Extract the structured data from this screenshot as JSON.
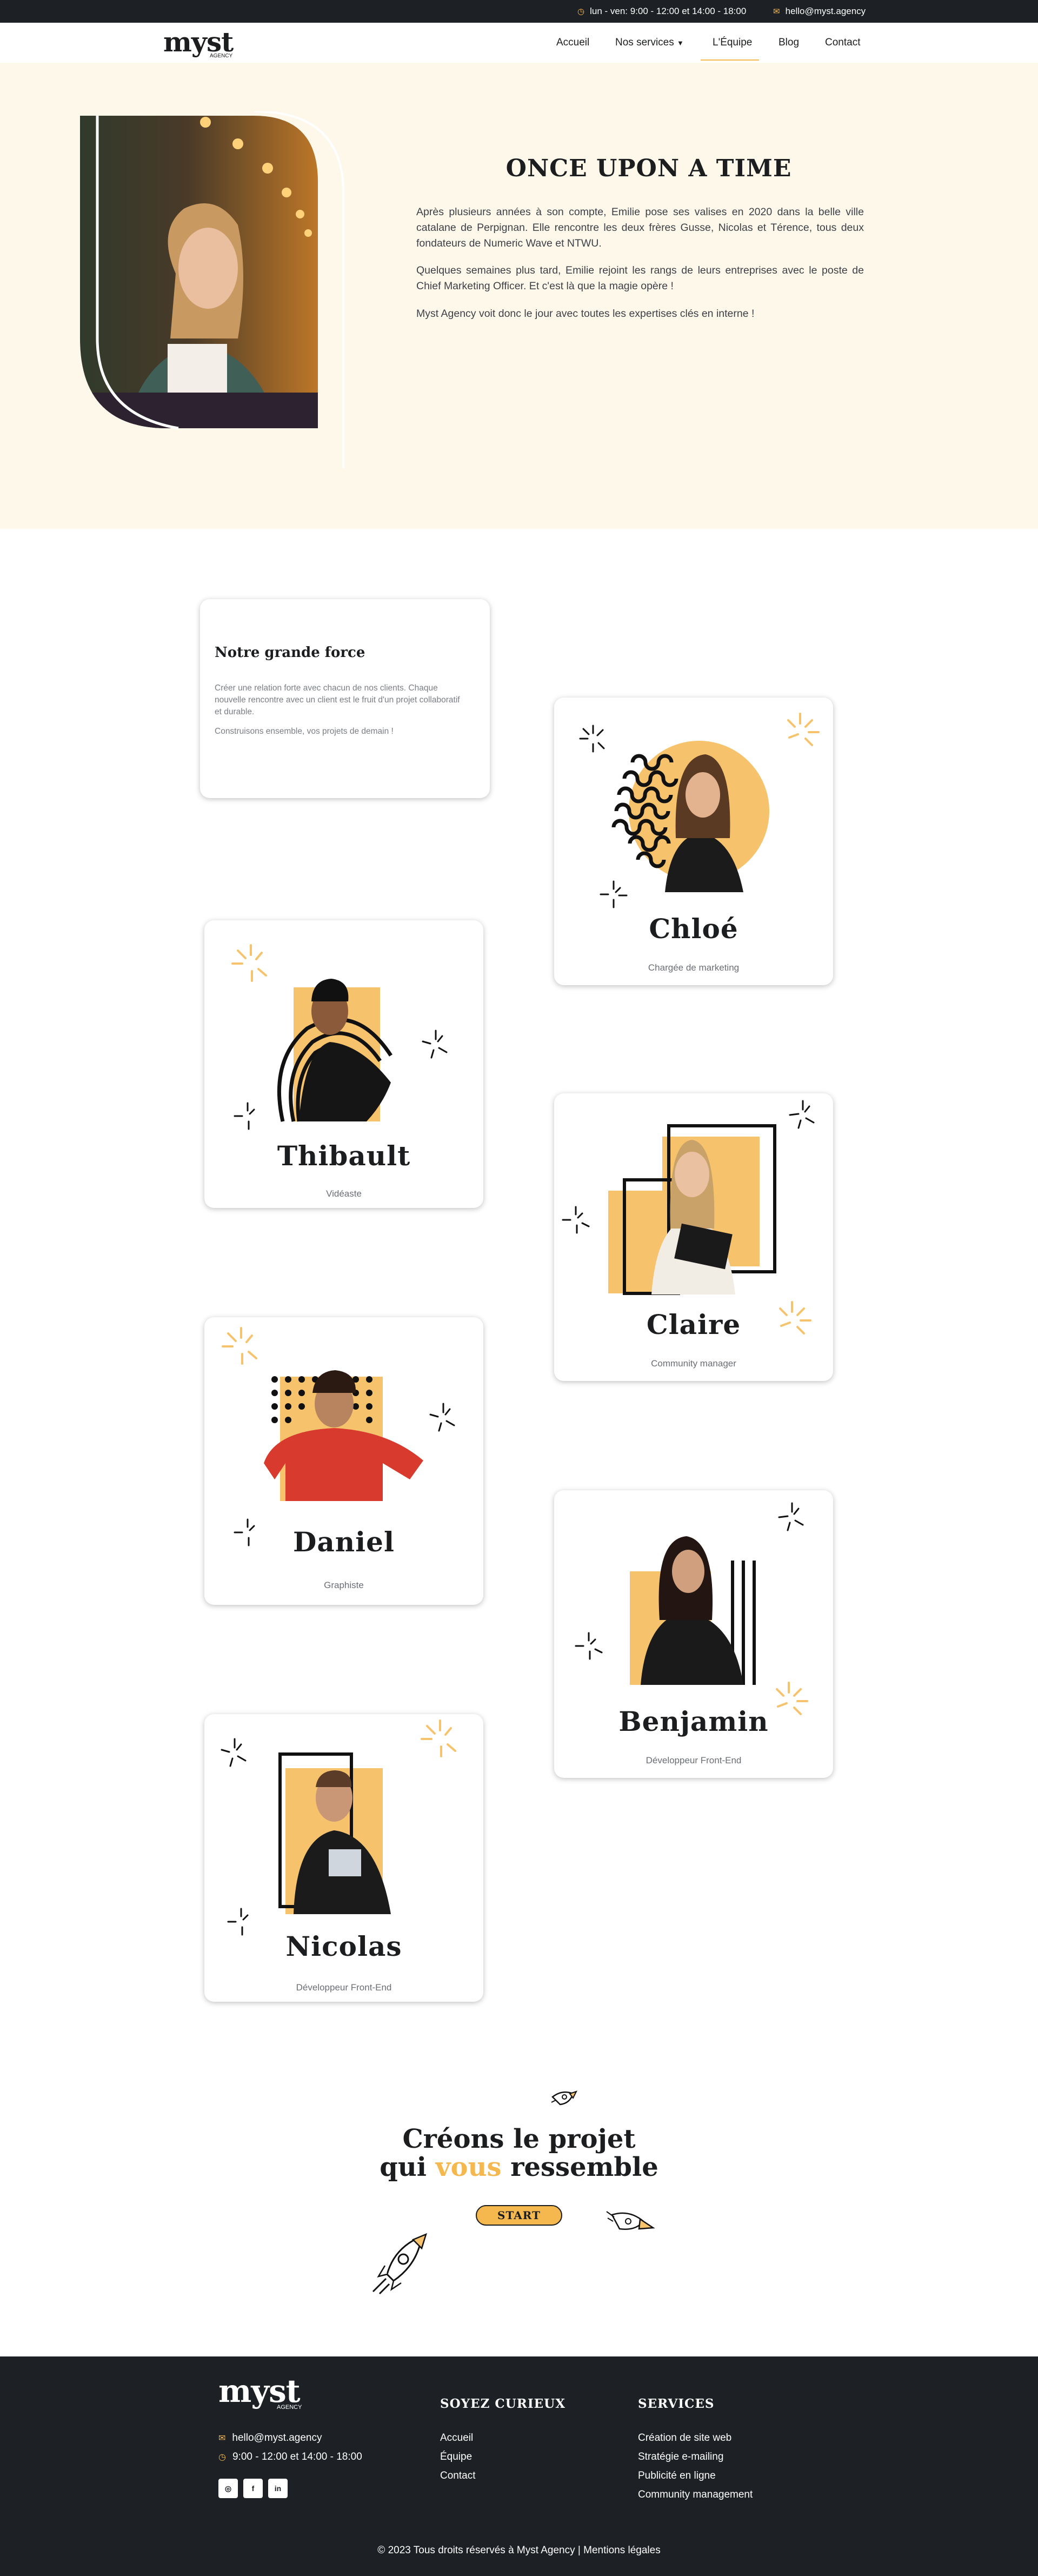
{
  "topbar": {
    "hours": "lun - ven: 9:00 - 12:00 et 14:00 - 18:00",
    "email": "hello@myst.agency",
    "clock_icon": "clock-icon",
    "mail_icon": "mail-icon"
  },
  "brand": {
    "name": "myst",
    "sub": "AGENCY"
  },
  "nav": {
    "items": [
      {
        "label": "Accueil"
      },
      {
        "label": "Nos services"
      },
      {
        "label": "L'Équipe",
        "active": true
      },
      {
        "label": "Blog"
      },
      {
        "label": "Contact"
      }
    ]
  },
  "hero": {
    "title": "ONCE UPON A TIME",
    "paragraphs": [
      "Après plusieurs années à son compte, Emilie pose ses valises en 2020 dans la belle ville catalane de Perpignan. Elle rencontre les deux frères Gusse, Nicolas et Térence, tous deux fondateurs de Numeric Wave et NTWU.",
      "Quelques semaines plus tard, Emilie rejoint les rangs de leurs entreprises avec le poste de Chief Marketing Officer. Et c'est là que la magie opère !",
      "Myst Agency voit donc le jour avec toutes les expertises clés en interne !"
    ]
  },
  "force": {
    "title": "Notre grande force",
    "text": "Créer une relation forte avec chacun de nos clients. Chaque nouvelle rencontre avec un client est le fruit d'un projet collaboratif et durable.",
    "text2": "Construisons ensemble, vos projets de demain !"
  },
  "team": [
    {
      "name": "Chloé",
      "role": "Chargée de marketing"
    },
    {
      "name": "Thibault",
      "role": "Vidéaste"
    },
    {
      "name": "Claire",
      "role": "Community manager"
    },
    {
      "name": "Daniel",
      "role": "Graphiste"
    },
    {
      "name": "Benjamin",
      "role": "Développeur Front-End"
    },
    {
      "name": "Nicolas",
      "role": "Développeur Front-End"
    }
  ],
  "cta": {
    "line1": "Créons le projet",
    "line2_pre": "qui ",
    "line2_accent": "vous",
    "line2_post": " ressemble",
    "button": "START"
  },
  "footer": {
    "email": "hello@myst.agency",
    "hours": "9:00 - 12:00 et 14:00 - 18:00",
    "col2_title": "SOYEZ CURIEUX",
    "col2_links": [
      "Accueil",
      "Équipe",
      "Contact"
    ],
    "col3_title": "SERVICES",
    "col3_links": [
      "Création de site web",
      "Stratégie e-mailing",
      "Publicité en ligne",
      "Community management"
    ],
    "socials": [
      "instagram-icon",
      "facebook-icon",
      "linkedin-icon"
    ],
    "copyright": "© 2023 Tous droits réservés à Myst Agency | Mentions légales"
  },
  "colors": {
    "accent": "#f5b84f",
    "dark": "#1d2024",
    "cream": "#fdf8ea"
  }
}
